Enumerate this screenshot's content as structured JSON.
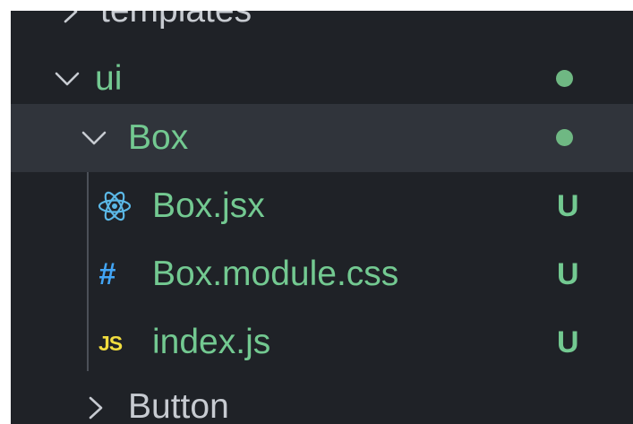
{
  "tree": {
    "items": [
      {
        "label": "templates",
        "chevron": "chevron-right"
      },
      {
        "label": "ui",
        "chevron": "chevron-down",
        "status": "modified-dot"
      },
      {
        "label": "Box",
        "chevron": "chevron-down",
        "status": "modified-dot",
        "selected": true
      },
      {
        "label": "Box.jsx",
        "icon": "react-icon",
        "status": "U"
      },
      {
        "label": "Box.module.css",
        "icon": "css-hash-icon",
        "icon_text": "#",
        "status": "U"
      },
      {
        "label": "index.js",
        "icon": "js-icon",
        "icon_text": "JS",
        "status": "U"
      },
      {
        "label": "Button",
        "chevron": "chevron-right"
      }
    ]
  },
  "colors": {
    "background": "#1f2227",
    "selected_row": "#30343b",
    "untracked_green": "#73c991",
    "folder_gray": "#c7cbd1",
    "css_blue": "#42a5f5",
    "js_yellow": "#f1dd3f",
    "react_blue": "#5bb8e6"
  }
}
